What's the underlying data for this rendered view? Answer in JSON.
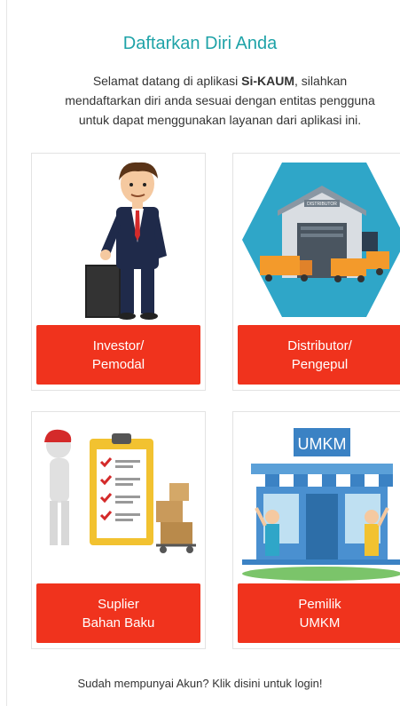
{
  "header": {
    "title": "Daftarkan Diri Anda",
    "intro_before": "Selamat datang di aplikasi ",
    "app_name": "Si-KAUM",
    "intro_line1_after": ", silahkan",
    "intro_line2": "mendaftarkan diri anda sesuai dengan entitas pengguna",
    "intro_line3": "untuk dapat menggunakan layanan dari aplikasi ini."
  },
  "cards": [
    {
      "line1": "Investor/",
      "line2": "Pemodal",
      "icon": "investor-businessman-icon"
    },
    {
      "line1": "Distributor/",
      "line2": "Pengepul",
      "icon": "distributor-warehouse-icon",
      "sign": "DISTRIBUTOR"
    },
    {
      "line1": "Suplier",
      "line2": "Bahan Baku",
      "icon": "supplier-checklist-icon"
    },
    {
      "line1": "Pemilik",
      "line2": "UMKM",
      "icon": "umkm-store-icon",
      "sign": "UMKM"
    }
  ],
  "footer": {
    "login_prompt": "Sudah mempunyai Akun? Klik disini untuk login!"
  },
  "colors": {
    "title": "#1fa3a8",
    "button": "#f0331d",
    "teal_hexagon": "#2fa6c8"
  }
}
